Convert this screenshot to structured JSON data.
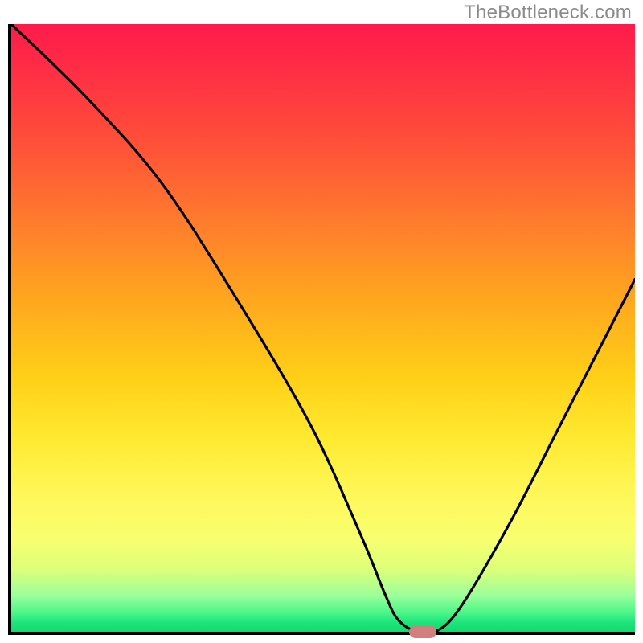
{
  "watermark": "TheBottleneck.com",
  "chart_data": {
    "type": "line",
    "title": "",
    "xlabel": "",
    "ylabel": "",
    "xlim": [
      0,
      100
    ],
    "ylim": [
      0,
      100
    ],
    "background_gradient": {
      "top_color": "#ff1a4a",
      "mid_color": "#ffe930",
      "bottom_color": "#16d86f",
      "meaning": "red = high bottleneck, green = low bottleneck"
    },
    "series": [
      {
        "name": "bottleneck-curve",
        "x": [
          0,
          12,
          24,
          36,
          48,
          56,
          60,
          62,
          65,
          68,
          72,
          80,
          88,
          96,
          100
        ],
        "values": [
          100,
          88,
          74,
          55,
          34,
          16,
          6,
          2,
          0,
          0,
          4,
          18,
          34,
          50,
          58
        ]
      }
    ],
    "marker": {
      "name": "optimal-point",
      "x": 66,
      "y": 0,
      "color": "#d47f7f"
    }
  }
}
